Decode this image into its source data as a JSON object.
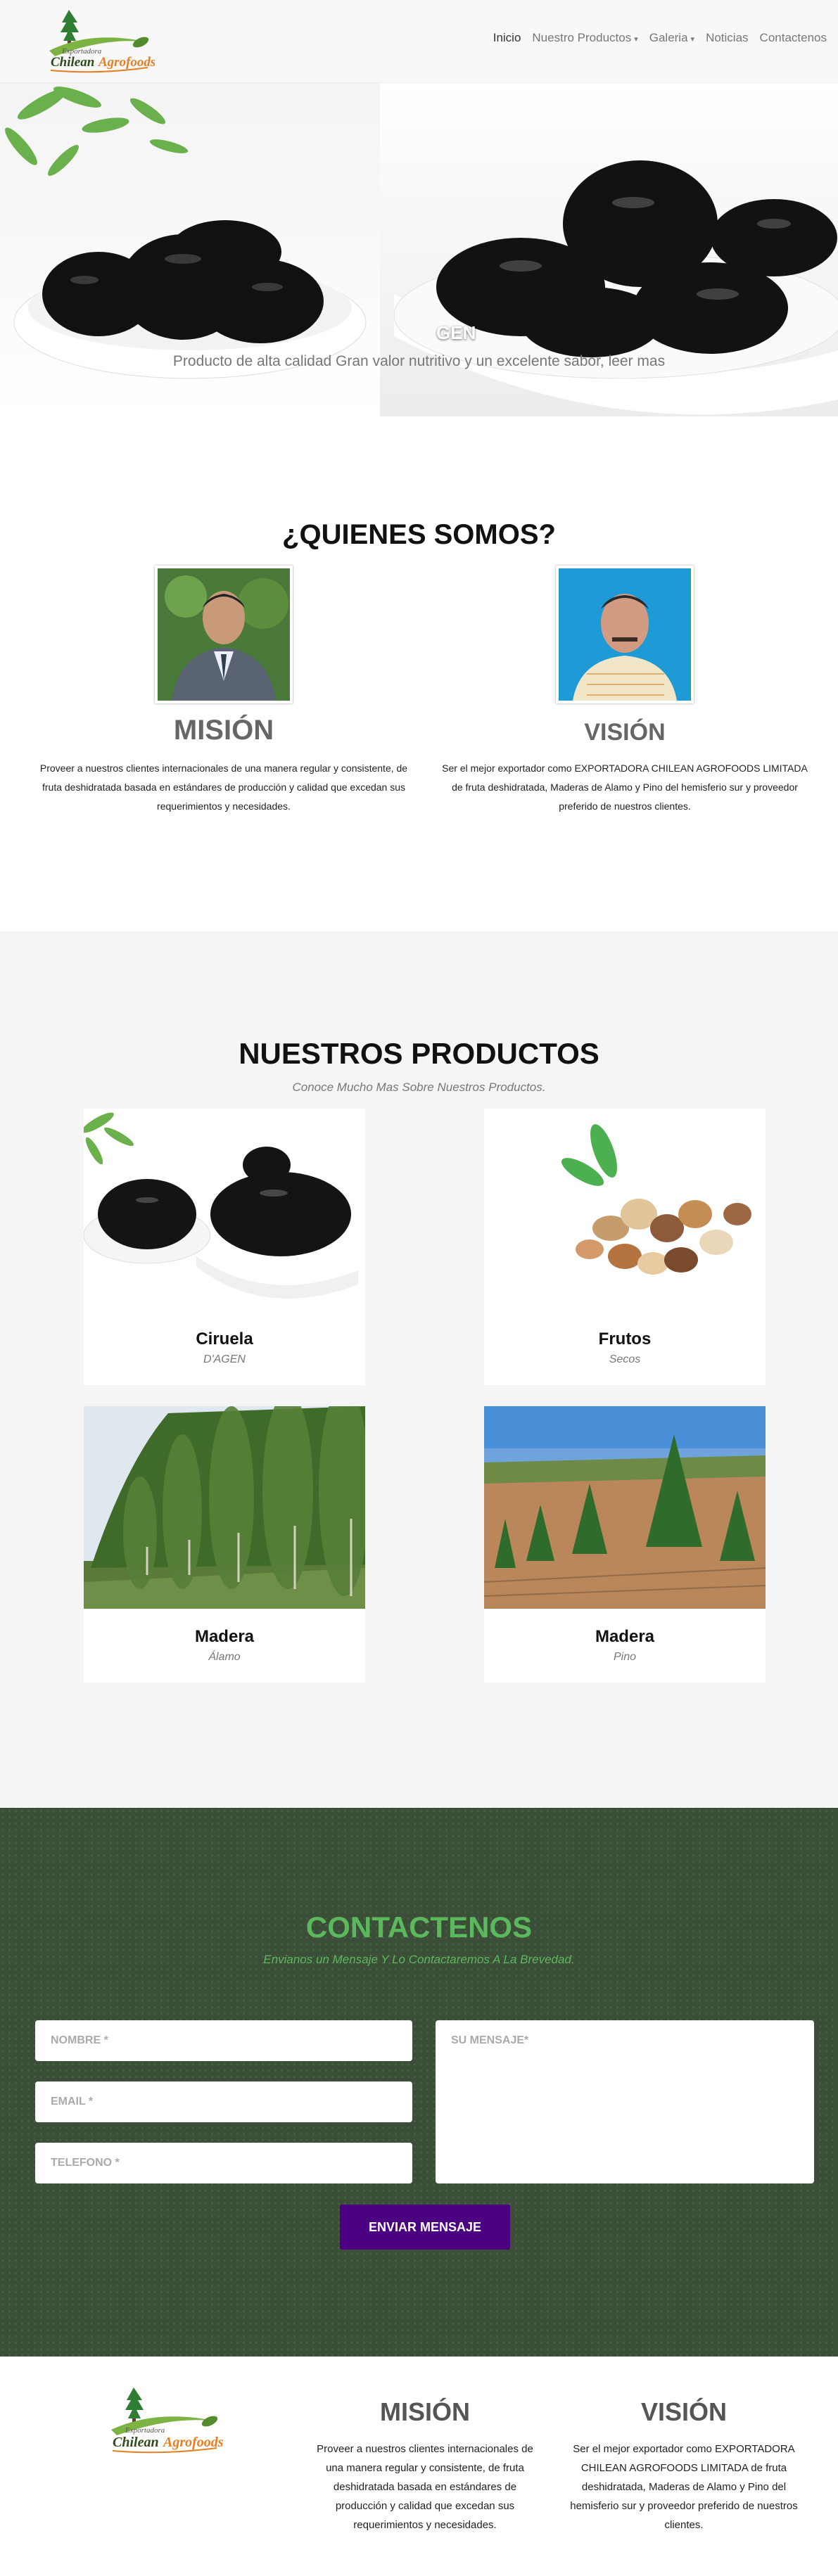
{
  "nav": {
    "logo_text_top": "Exportadora",
    "logo_text_main": "Chilean",
    "logo_text_accent": "Agrofoods",
    "items": [
      {
        "label": "Inicio",
        "active": true,
        "dropdown": false
      },
      {
        "label": "Nuestro Productos",
        "active": false,
        "dropdown": true
      },
      {
        "label": "Galeria",
        "active": false,
        "dropdown": true
      },
      {
        "label": "Noticias",
        "active": false,
        "dropdown": false
      },
      {
        "label": "Contactenos",
        "active": false,
        "dropdown": false
      }
    ]
  },
  "hero": {
    "title_fragment": "GEN",
    "caption": "Producto de alta calidad Gran valor nutritivo y un excelente sabor, leer mas"
  },
  "about": {
    "title": "¿QUIENES SOMOS?",
    "mision": {
      "title": "MISIÓN",
      "text": "Proveer a nuestros clientes internacionales de una manera regular y consistente, de fruta deshidratada basada en estándares de producción y calidad que excedan sus requerimientos y necesidades."
    },
    "vision": {
      "title": "VISIÓN",
      "text": "Ser el mejor exportador como EXPORTADORA CHILEAN AGROFOODS LIMITADA de fruta deshidratada, Maderas de Alamo y Pino del hemisferio sur y proveedor preferido de nuestros clientes."
    }
  },
  "products": {
    "title": "NUESTROS PRODUCTOS",
    "subtitle": "Conoce Mucho Mas Sobre Nuestros Productos.",
    "items": [
      {
        "name": "Ciruela",
        "caption": "D'AGEN"
      },
      {
        "name": "Frutos",
        "caption": "Secos"
      },
      {
        "name": "Madera",
        "caption": "Álamo"
      },
      {
        "name": "Madera",
        "caption": "Pino"
      }
    ]
  },
  "contact": {
    "title": "CONTACTENOS",
    "subtitle": "Envianos un Mensaje Y Lo Contactaremos A La Brevedad.",
    "name_placeholder": "NOMBRE *",
    "email_placeholder": "EMAIL *",
    "phone_placeholder": "TELEFONO *",
    "message_placeholder": "SU MENSAJE*",
    "send_label": "ENVIAR MENSAJE"
  },
  "footer": {
    "mision_title": "MISIÓN",
    "mision_text": "Proveer a nuestros clientes internacionales de una manera regular y consistente, de fruta deshidratada basada en estándares de producción y calidad que excedan sus requerimientos y necesidades.",
    "vision_title": "VISIÓN",
    "vision_text": "Ser el mejor exportador como EXPORTADORA CHILEAN AGROFOODS LIMITADA de fruta deshidratada, Maderas de Alamo y Pino del hemisferio sur y proveedor preferido de nuestros clientes."
  }
}
